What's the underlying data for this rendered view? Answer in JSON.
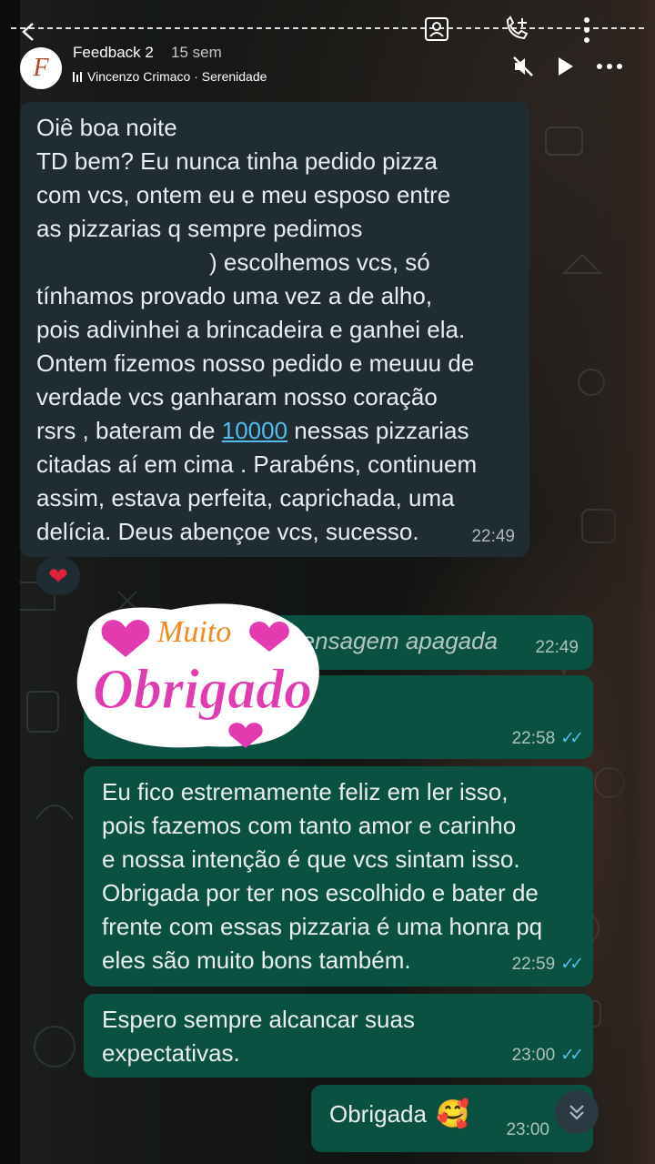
{
  "story": {
    "title": "Feedback 2",
    "age": "15 sem",
    "music": "Vincenzo Crimaco · Serenidade",
    "avatar_letter": "F"
  },
  "messages": {
    "m1_lines": [
      "Oiê boa noite",
      "TD bem? Eu nunca tinha pedido pizza",
      "com vcs, ontem eu e meu esposo entre",
      "as pizzarias q sempre pedimos",
      ") escolhemos vcs, só",
      "tínhamos provado uma vez a de alho,",
      "pois adivinhei a brincadeira e ganhei ela.",
      "Ontem fizemos nosso pedido e meuuu de",
      "verdade vcs ganharam nosso coração",
      "rsrs , bateram de",
      "10000",
      "nessas pizzarias",
      "citadas aí em cima . Parabéns, continuem",
      "assim, estava perfeita, caprichada, uma",
      "delícia. Deus abençoe vcs, sucesso."
    ],
    "m1_time": "22:49",
    "reaction": "❤",
    "deleted_text": "Mensagem apagada",
    "deleted_time": "22:49",
    "sticker_top": "Muito",
    "sticker_main": "Obrigado",
    "sticker_time": "22:58",
    "m3_lines": [
      "Eu fico estremamente feliz em ler isso,",
      "pois fazemos com tanto amor e carinho",
      "e nossa intenção é que vcs sintam isso.",
      "Obrigada por ter nos escolhido e bater de",
      "frente com essas pizzaria é uma honra pq",
      "eles são muito bons também."
    ],
    "m3_time": "22:59",
    "m4_lines": [
      "Espero sempre alcancar suas",
      "expectativas."
    ],
    "m4_time": "23:00",
    "m5_text": "Obrigada",
    "m5_emoji": "🥰",
    "m5_time": "23:00"
  },
  "colors": {
    "incoming": "#1f2c33",
    "outgoing": "#0b5142",
    "read_ticks": "#53bdeb",
    "sticker_pink": "#e23bb0",
    "sticker_orange": "#f08a1c"
  },
  "icons": [
    "back-arrow-icon",
    "photo-frame-icon",
    "call-add-icon",
    "more-vert-icon",
    "mute-icon",
    "play-icon",
    "more-horiz-icon",
    "music-bars-icon",
    "heart-icon",
    "chevron-down-double-icon"
  ]
}
